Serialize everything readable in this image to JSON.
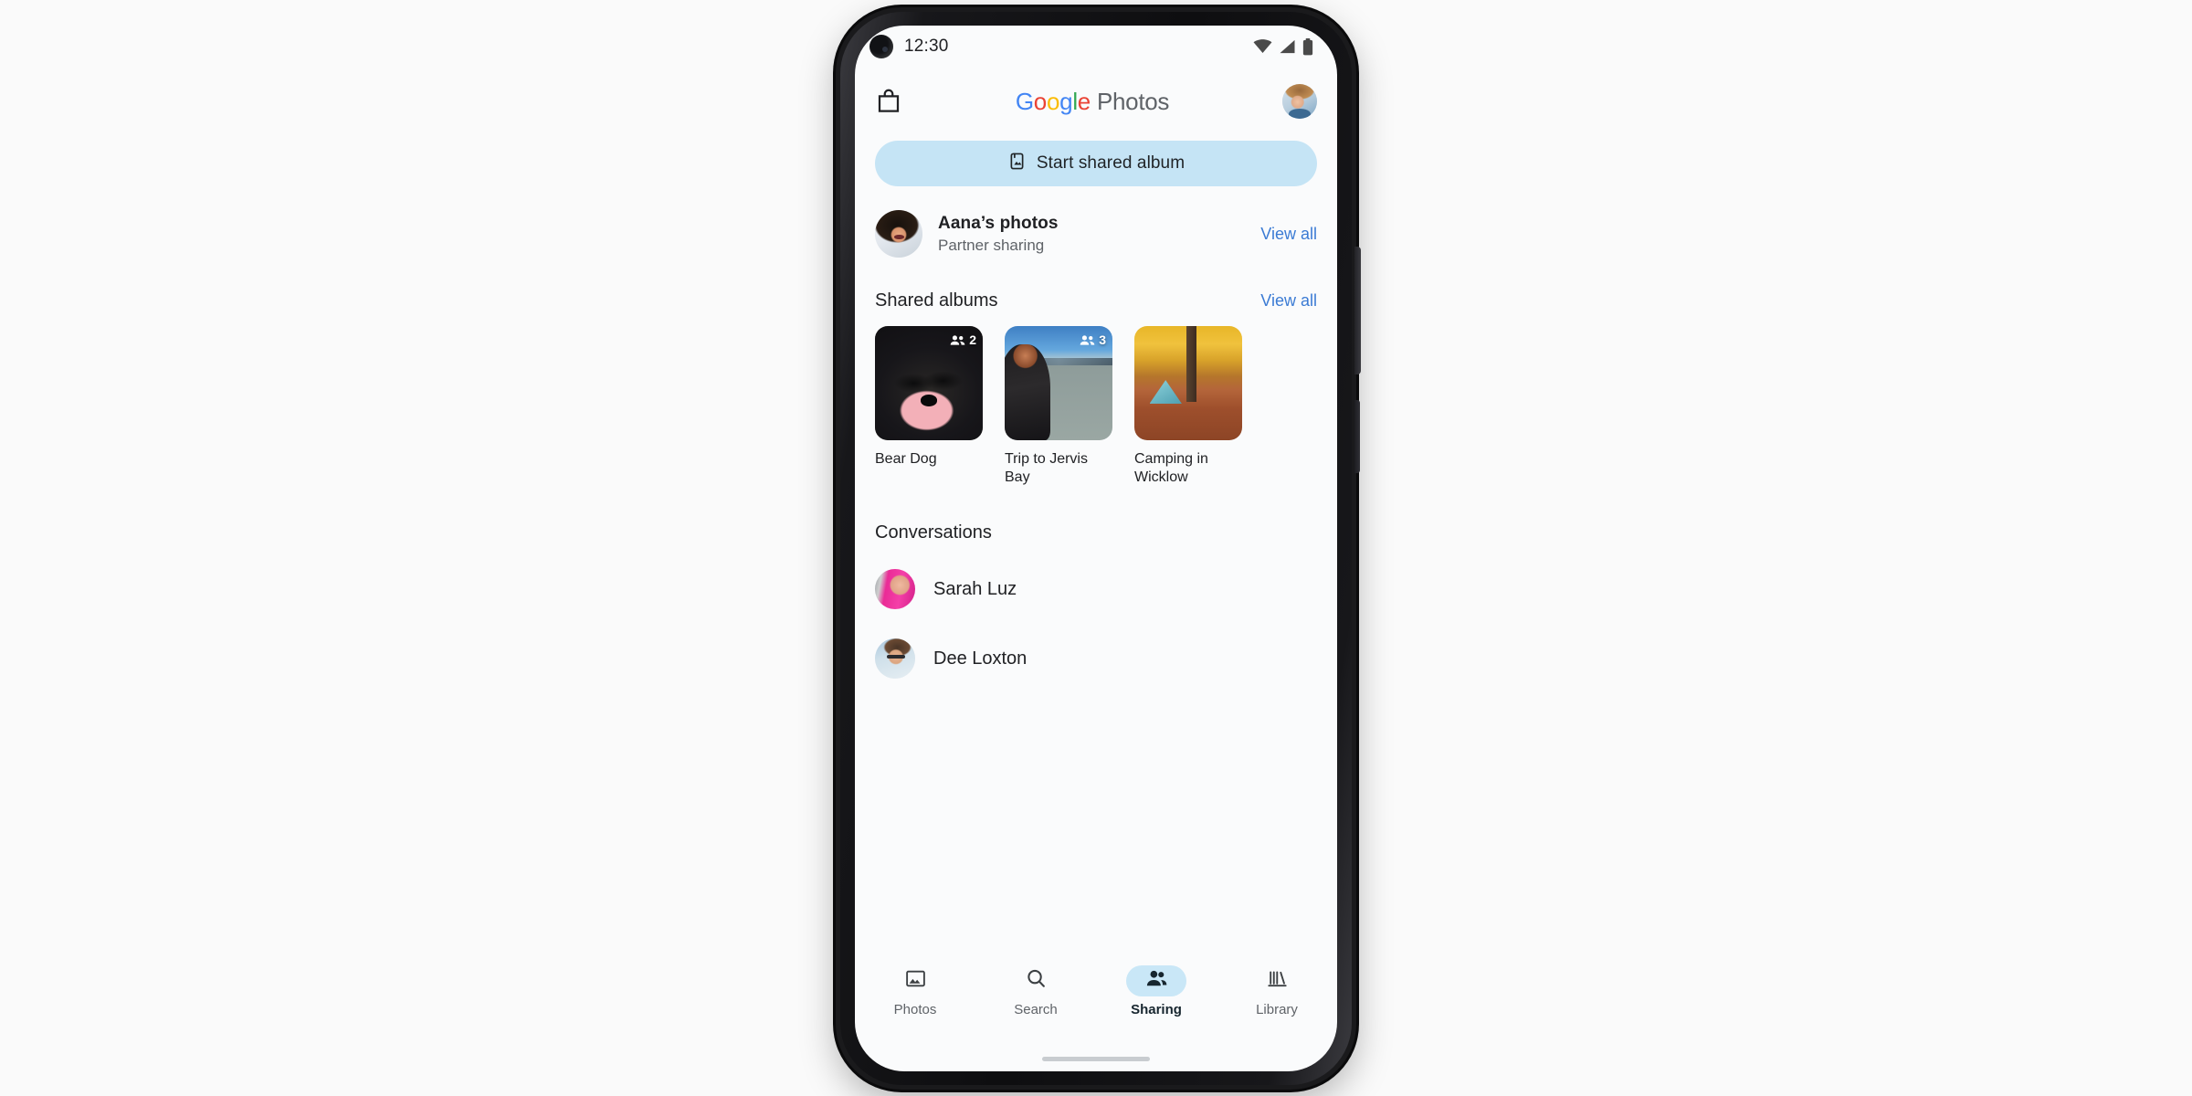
{
  "device": {
    "side_button": "power-button",
    "volume_button": "volume-button",
    "gesture_bar": "home-gesture-bar"
  },
  "status_bar": {
    "time": "12:30",
    "icons": [
      "wifi-icon",
      "cellular-signal-icon",
      "battery-icon"
    ],
    "camera": "front-camera-punch-hole"
  },
  "app_bar": {
    "store_icon": "shopping-bag-icon",
    "brand": {
      "g1": "G",
      "o1": "o",
      "o2": "o",
      "g2": "g",
      "l": "l",
      "e": "e",
      "word2": "Photos"
    },
    "account_avatar": "account-avatar"
  },
  "primary_action": {
    "icon": "photo-album-icon",
    "label": "Start shared album",
    "background": "#c5e4f5"
  },
  "partner_sharing": {
    "avatar": "aana-avatar",
    "title": "Aana’s photos",
    "subtitle": "Partner sharing",
    "action_label": "View all"
  },
  "shared_albums": {
    "section_title": "Shared albums",
    "action_label": "View all",
    "items": [
      {
        "name": "Bear Dog",
        "member_count": "2",
        "thumb": "black-dog-photo"
      },
      {
        "name": "Trip to Jervis Bay",
        "member_count": "3",
        "thumb": "beach-coast-photo"
      },
      {
        "name": "Camping in Wicklow",
        "member_count": "",
        "thumb": "autumn-camping-photo"
      }
    ]
  },
  "conversations": {
    "section_title": "Conversations",
    "items": [
      {
        "name": "Sarah Luz",
        "avatar": "sarah-luz-avatar"
      },
      {
        "name": "Dee Loxton",
        "avatar": "dee-loxton-avatar"
      }
    ]
  },
  "bottom_nav": {
    "active_index": 2,
    "active_pill_color": "#c9e7f7",
    "items": [
      {
        "label": "Photos",
        "icon": "photos-image-icon"
      },
      {
        "label": "Search",
        "icon": "search-magnifier-icon"
      },
      {
        "label": "Sharing",
        "icon": "people-sharing-icon"
      },
      {
        "label": "Library",
        "icon": "library-books-icon"
      }
    ]
  },
  "colors": {
    "accent_blue": "#3b7bd4",
    "pill_blue": "#c5e4f5",
    "text_primary": "#202124",
    "text_secondary": "#5f6368",
    "page_background": "#fafafa"
  }
}
